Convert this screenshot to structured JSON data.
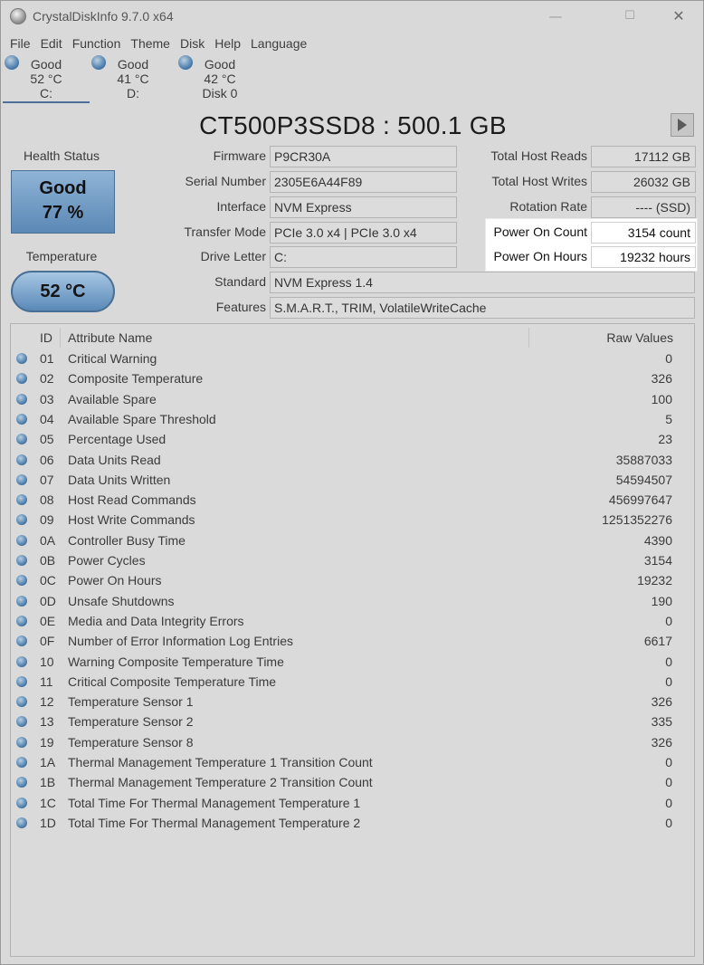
{
  "window": {
    "title": "CrystalDiskInfo 9.7.0 x64",
    "minimize_glyph": "—",
    "maximize_glyph": "☐",
    "close_glyph": "✕"
  },
  "menu": [
    "File",
    "Edit",
    "Function",
    "Theme",
    "Disk",
    "Help",
    "Language"
  ],
  "disks": [
    {
      "status": "Good",
      "temp": "52 °C",
      "label": "C:",
      "selected": true
    },
    {
      "status": "Good",
      "temp": "41 °C",
      "label": "D:",
      "selected": false
    },
    {
      "status": "Good",
      "temp": "42 °C",
      "label": "Disk 0",
      "selected": false
    }
  ],
  "drive": {
    "model": "CT500P3SSD8 : 500.1 GB",
    "health_label": "Health Status",
    "health_status": "Good",
    "health_percent": "77 %",
    "temperature_label": "Temperature",
    "temperature": "52 °C"
  },
  "info_left": [
    {
      "label": "Firmware",
      "value": "P9CR30A"
    },
    {
      "label": "Serial Number",
      "value": "2305E6A44F89"
    },
    {
      "label": "Interface",
      "value": "NVM Express"
    },
    {
      "label": "Transfer Mode",
      "value": "PCIe 3.0 x4 | PCIe 3.0 x4"
    },
    {
      "label": "Drive Letter",
      "value": "C:"
    },
    {
      "label": "Standard",
      "value": "NVM Express 1.4"
    },
    {
      "label": "Features",
      "value": "S.M.A.R.T., TRIM, VolatileWriteCache"
    }
  ],
  "info_right": [
    {
      "label": "Total Host Reads",
      "value": "17112 GB"
    },
    {
      "label": "Total Host Writes",
      "value": "26032 GB"
    },
    {
      "label": "Rotation Rate",
      "value": "---- (SSD)"
    },
    {
      "label": "Power On Count",
      "value": "3154 count"
    },
    {
      "label": "Power On Hours",
      "value": "19232 hours"
    }
  ],
  "table": {
    "headers": {
      "id": "ID",
      "name": "Attribute Name",
      "raw": "Raw Values"
    },
    "rows": [
      {
        "id": "01",
        "name": "Critical Warning",
        "raw": "0"
      },
      {
        "id": "02",
        "name": "Composite Temperature",
        "raw": "326"
      },
      {
        "id": "03",
        "name": "Available Spare",
        "raw": "100"
      },
      {
        "id": "04",
        "name": "Available Spare Threshold",
        "raw": "5"
      },
      {
        "id": "05",
        "name": "Percentage Used",
        "raw": "23"
      },
      {
        "id": "06",
        "name": "Data Units Read",
        "raw": "35887033"
      },
      {
        "id": "07",
        "name": "Data Units Written",
        "raw": "54594507"
      },
      {
        "id": "08",
        "name": "Host Read Commands",
        "raw": "456997647"
      },
      {
        "id": "09",
        "name": "Host Write Commands",
        "raw": "1251352276"
      },
      {
        "id": "0A",
        "name": "Controller Busy Time",
        "raw": "4390"
      },
      {
        "id": "0B",
        "name": "Power Cycles",
        "raw": "3154"
      },
      {
        "id": "0C",
        "name": "Power On Hours",
        "raw": "19232"
      },
      {
        "id": "0D",
        "name": "Unsafe Shutdowns",
        "raw": "190"
      },
      {
        "id": "0E",
        "name": "Media and Data Integrity Errors",
        "raw": "0"
      },
      {
        "id": "0F",
        "name": "Number of Error Information Log Entries",
        "raw": "6617"
      },
      {
        "id": "10",
        "name": "Warning Composite Temperature Time",
        "raw": "0"
      },
      {
        "id": "11",
        "name": "Critical Composite Temperature Time",
        "raw": "0"
      },
      {
        "id": "12",
        "name": "Temperature Sensor 1",
        "raw": "326"
      },
      {
        "id": "13",
        "name": "Temperature Sensor 2",
        "raw": "335"
      },
      {
        "id": "19",
        "name": "Temperature Sensor 8",
        "raw": "326"
      },
      {
        "id": "1A",
        "name": "Thermal Management Temperature 1 Transition Count",
        "raw": "0"
      },
      {
        "id": "1B",
        "name": "Thermal Management Temperature 2 Transition Count",
        "raw": "0"
      },
      {
        "id": "1C",
        "name": "Total Time For Thermal Management Temperature 1",
        "raw": "0"
      },
      {
        "id": "1D",
        "name": "Total Time For Thermal Management Temperature 2",
        "raw": "0"
      }
    ]
  },
  "colors": {
    "accent_blue": "#5b88b6",
    "status_dot": "#3a6e9e",
    "highlight_bg": "#ffffff"
  }
}
